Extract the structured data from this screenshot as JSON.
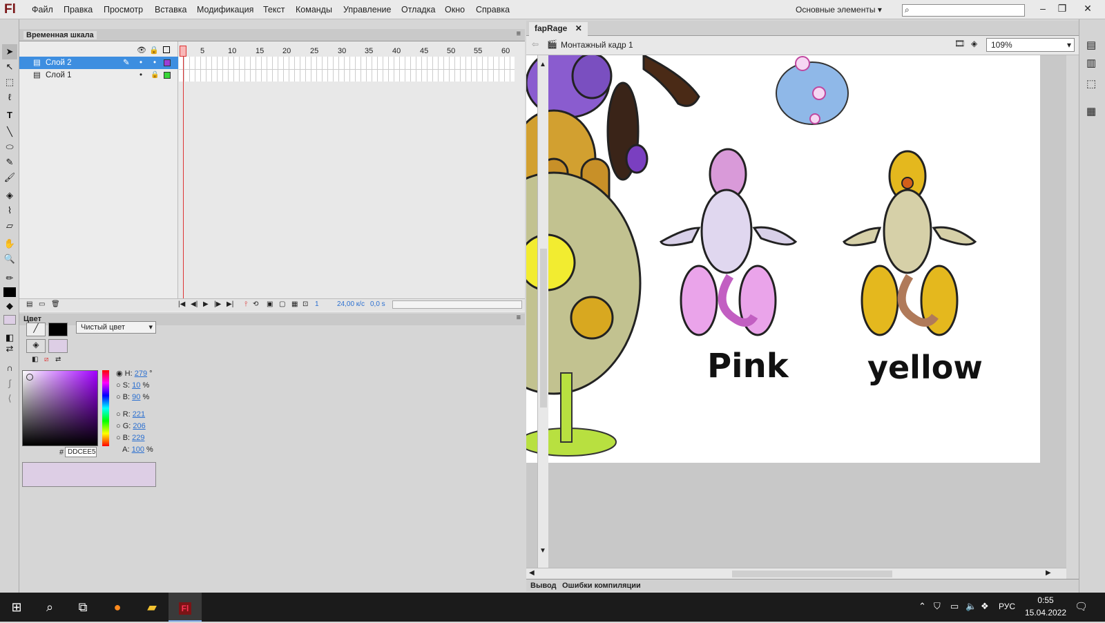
{
  "app": {
    "logo": "Fl"
  },
  "menu": [
    "Файл",
    "Правка",
    "Просмотр",
    "Вставка",
    "Модификация",
    "Текст",
    "Команды",
    "Управление",
    "Отладка",
    "Окно",
    "Справка"
  ],
  "workspace": "Основные элементы",
  "search": {
    "placeholder": ""
  },
  "timeline": {
    "tab": "Временная шкала",
    "layers": [
      {
        "name": "Слой 2",
        "selected": true,
        "color": "#9b3fd6"
      },
      {
        "name": "Слой 1",
        "selected": false,
        "color": "#38d638"
      }
    ],
    "frame_numbers": [
      "1",
      "5",
      "10",
      "15",
      "20",
      "25",
      "30",
      "35",
      "40",
      "45",
      "50",
      "55",
      "60"
    ],
    "footer": {
      "frame": "1",
      "fps": "24,00 к/с",
      "time": "0,0 s"
    }
  },
  "color": {
    "tab": "Цвет",
    "fill_type": "Чистый цвет",
    "H": "279",
    "S": "10",
    "B": "90",
    "R": "221",
    "G": "206",
    "Bl": "229",
    "A": "100",
    "hex": "DDCEE5",
    "swatch": "#ddcee5",
    "deg": "°",
    "pct": "%"
  },
  "document": {
    "tab": "fapRage",
    "scene": "Монтажный кадр 1",
    "zoom": "109%",
    "labels": {
      "pink": "Pink",
      "yellow": "yellow"
    }
  },
  "output_tabs": [
    "Вывод",
    "Ошибки компиляции"
  ],
  "taskbar": {
    "lang": "РУС",
    "time": "0:55",
    "date": "15.04.2022"
  }
}
